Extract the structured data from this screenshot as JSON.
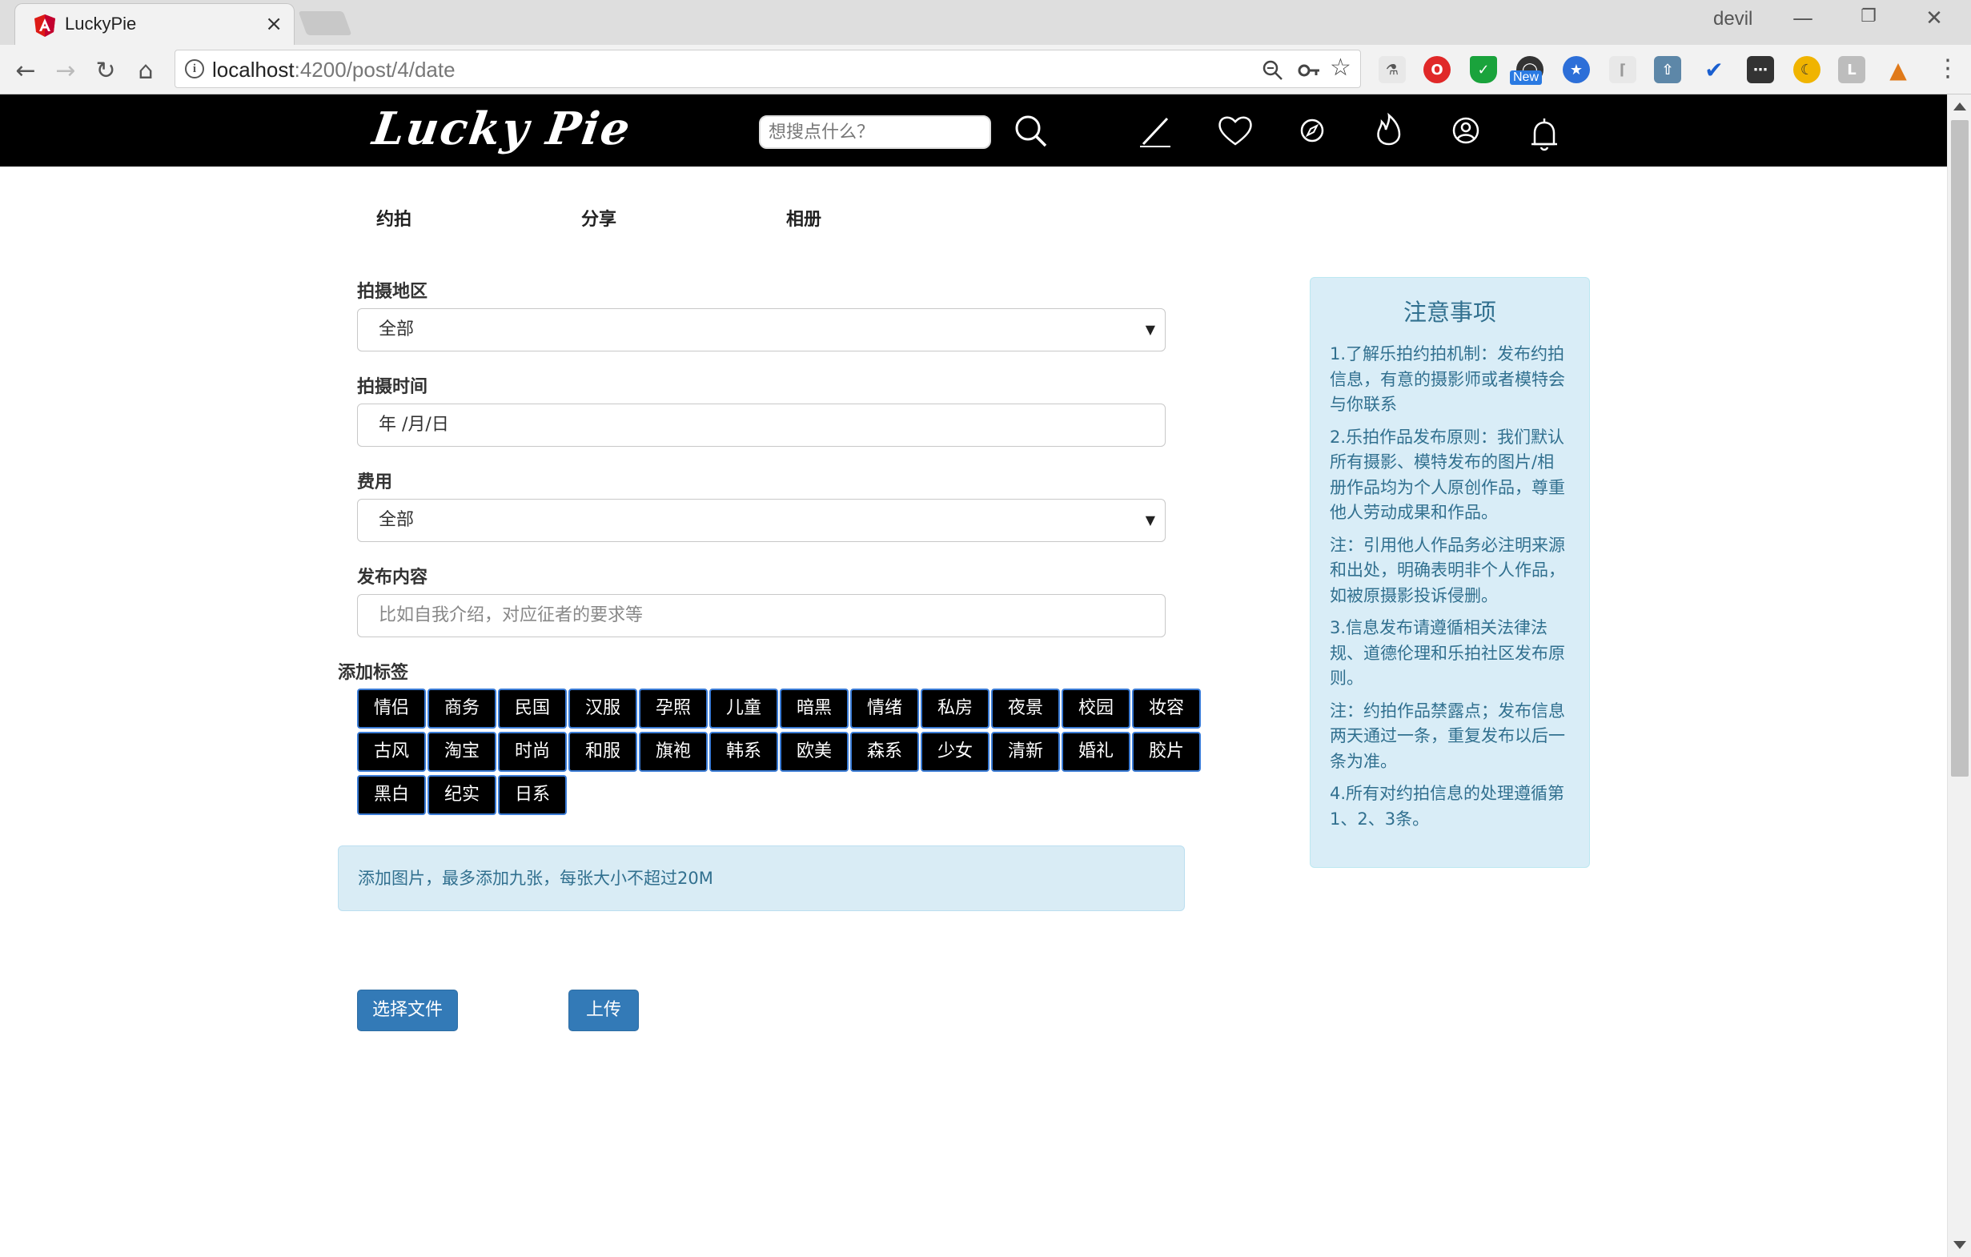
{
  "browser": {
    "tab_title": "LuckyPie",
    "tab_close": "×",
    "user_name": "devil",
    "url_host": "localhost",
    "url_path": ":4200/post/4/date",
    "ext_new_badge": "New",
    "window_minimize": "—",
    "window_restore": "❐",
    "window_close": "✕"
  },
  "header": {
    "logo_text": "Lucky Pie",
    "search_placeholder": "想搜点什么？",
    "icons": [
      "search-icon",
      "pen-icon",
      "heart-icon",
      "compass-icon",
      "flame-icon",
      "user-icon",
      "bell-icon"
    ]
  },
  "subnav": [
    "约拍",
    "分享",
    "相册"
  ],
  "form": {
    "region_label": "拍摄地区",
    "region_value": "全部",
    "time_label": "拍摄时间",
    "time_value": "年 /月/日",
    "fee_label": "费用",
    "fee_value": "全部",
    "content_label": "发布内容",
    "content_placeholder": "比如自我介绍，对应征者的要求等",
    "tags_label": "添加标签",
    "tags": [
      "情侣",
      "商务",
      "民国",
      "汉服",
      "孕照",
      "儿童",
      "暗黑",
      "情绪",
      "私房",
      "夜景",
      "校园",
      "妆容",
      "古风",
      "淘宝",
      "时尚",
      "和服",
      "旗袍",
      "韩系",
      "欧美",
      "森系",
      "少女",
      "清新",
      "婚礼",
      "胶片",
      "黑白",
      "纪实",
      "日系"
    ],
    "upload_hint": "添加图片，最多添加九张，每张大小不超过20M",
    "choose_file_label": "选择文件",
    "upload_label": "上传"
  },
  "notice": {
    "title": "注意事项",
    "items": [
      "1.了解乐拍约拍机制：发布约拍信息，有意的摄影师或者模特会与你联系",
      "2.乐拍作品发布原则：我们默认所有摄影、模特发布的图片/相册作品均为个人原创作品，尊重他人劳动成果和作品。",
      "注：引用他人作品务必注明来源和出处，明确表明非个人作品，如被原摄影投诉侵删。",
      "3.信息发布请遵循相关法律法规、道德伦理和乐拍社区发布原则。",
      "注：约拍作品禁露点；发布信息两天通过一条，重复发布以后一条为准。",
      "4.所有对约拍信息的处理遵循第1、2、3条。"
    ]
  },
  "colors": {
    "header_bg": "#000000",
    "button_blue": "#337ab7",
    "tag_border": "#3a7bd5",
    "info_bg": "#d9edf7",
    "info_text": "#31708f"
  }
}
